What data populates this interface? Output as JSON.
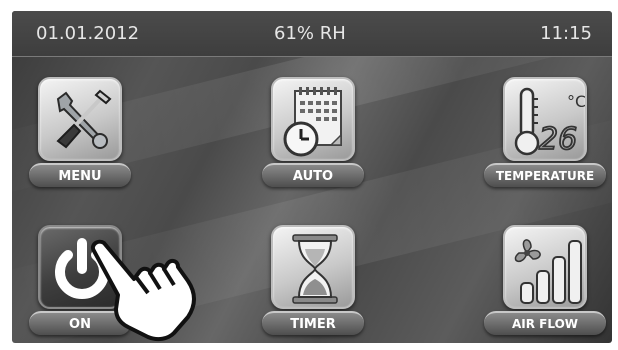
{
  "status": {
    "date": "01.01.2012",
    "humidity": "61% RH",
    "time": "11:15"
  },
  "tiles": [
    {
      "label": "MENU",
      "icon": "wrench-screwdriver-icon"
    },
    {
      "label": "AUTO",
      "icon": "calendar-clock-icon"
    },
    {
      "label": "TEMPERATURE",
      "icon": "thermometer-icon",
      "reading": "26",
      "unit": "°C"
    },
    {
      "label": "ON",
      "icon": "power-icon"
    },
    {
      "label": "TIMER",
      "icon": "hourglass-icon"
    },
    {
      "label": "AIR FLOW",
      "icon": "fan-bars-icon"
    }
  ],
  "pointer": {
    "icon": "hand-pointer-icon"
  },
  "colors": {
    "screen_bg": "#4a4a4a",
    "status_text": "#e6e6e6",
    "tile_light": "#dcdcdc",
    "tile_dark": "#3e3e3e"
  }
}
